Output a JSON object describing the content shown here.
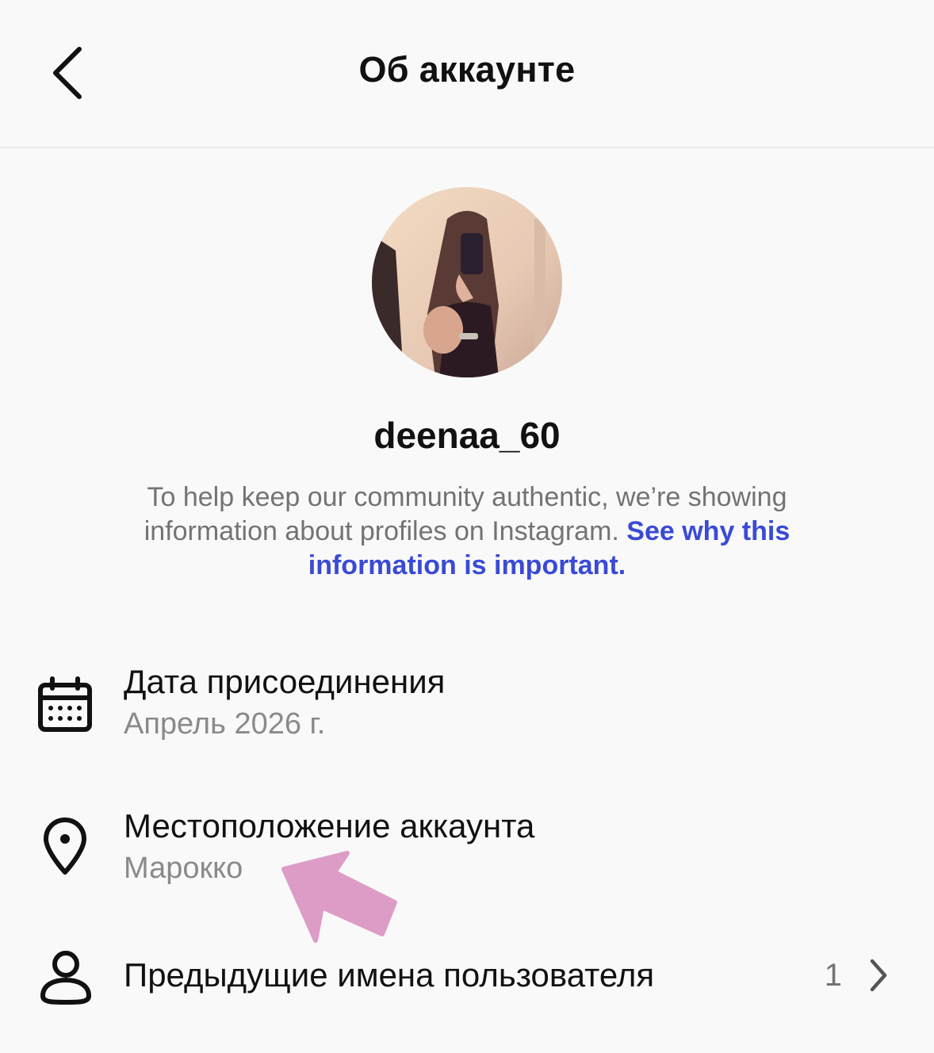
{
  "header": {
    "title": "Об аккаунте"
  },
  "profile": {
    "username": "deenaa_60",
    "info_text": "To help keep our community authentic, we’re showing information about profiles on Instagram.",
    "info_link": "See why this information is important."
  },
  "rows": {
    "date_joined": {
      "title": "Дата присоединения",
      "value": "Апрель 2026 г."
    },
    "location": {
      "title": "Местоположение аккаунта",
      "value": "Марокко"
    },
    "former_usernames": {
      "title": "Предыдущие имена пользователя",
      "count": "1"
    }
  },
  "colors": {
    "link": "#3a4ad6",
    "annotation_arrow": "#dd9cc6"
  }
}
